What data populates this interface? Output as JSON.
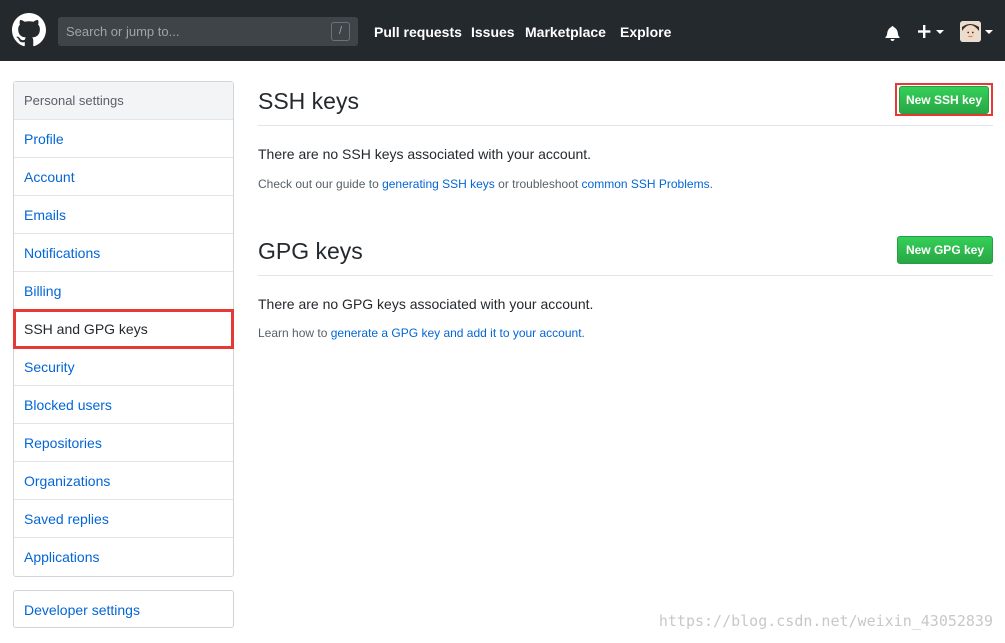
{
  "header": {
    "search_placeholder": "Search or jump to...",
    "search_shortcut": "/",
    "nav": [
      "Pull requests",
      "Issues",
      "Marketplace",
      "Explore"
    ],
    "bg_color": "#24292e"
  },
  "sidebar": {
    "heading": "Personal settings",
    "items": [
      {
        "label": "Profile"
      },
      {
        "label": "Account"
      },
      {
        "label": "Emails"
      },
      {
        "label": "Notifications"
      },
      {
        "label": "Billing"
      },
      {
        "label": "SSH and GPG keys",
        "active": true
      },
      {
        "label": "Security"
      },
      {
        "label": "Blocked users"
      },
      {
        "label": "Repositories"
      },
      {
        "label": "Organizations"
      },
      {
        "label": "Saved replies"
      },
      {
        "label": "Applications"
      }
    ],
    "developer_settings": "Developer settings"
  },
  "ssh": {
    "title": "SSH keys",
    "button": "New SSH key",
    "empty_text": "There are no SSH keys associated with your account.",
    "note_prefix": "Check out our guide to ",
    "note_link1": "generating SSH keys",
    "note_middle": " or troubleshoot ",
    "note_link2": "common SSH Problems",
    "note_suffix": "."
  },
  "gpg": {
    "title": "GPG keys",
    "button": "New GPG key",
    "empty_text": "There are no GPG keys associated with your account.",
    "note_prefix": "Learn how to ",
    "note_link": "generate a GPG key and add it to your account",
    "note_suffix": "."
  },
  "watermark": "https://blog.csdn.net/weixin_43052839",
  "colors": {
    "link": "#0366d6",
    "button_green": "#28a745",
    "highlight_red": "#e53935"
  }
}
